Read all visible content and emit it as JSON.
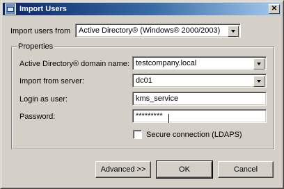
{
  "window": {
    "title": "Import Users",
    "close_label": "✕"
  },
  "import_from": {
    "label": "Import users from",
    "value": "Active Directory® (Windows® 2000/2003)"
  },
  "properties": {
    "legend": "Properties",
    "domain": {
      "label": "Active Directory® domain name:",
      "value": "testcompany.local"
    },
    "server": {
      "label": "Import from server:",
      "value": "dc01"
    },
    "login": {
      "label": "Login as user:",
      "value": "kms_service"
    },
    "password": {
      "label": "Password:",
      "value": "*********"
    },
    "secure": {
      "label": "Secure connection (LDAPS)",
      "checked": false
    }
  },
  "buttons": {
    "advanced": "Advanced >>",
    "ok": "OK",
    "cancel": "Cancel"
  }
}
